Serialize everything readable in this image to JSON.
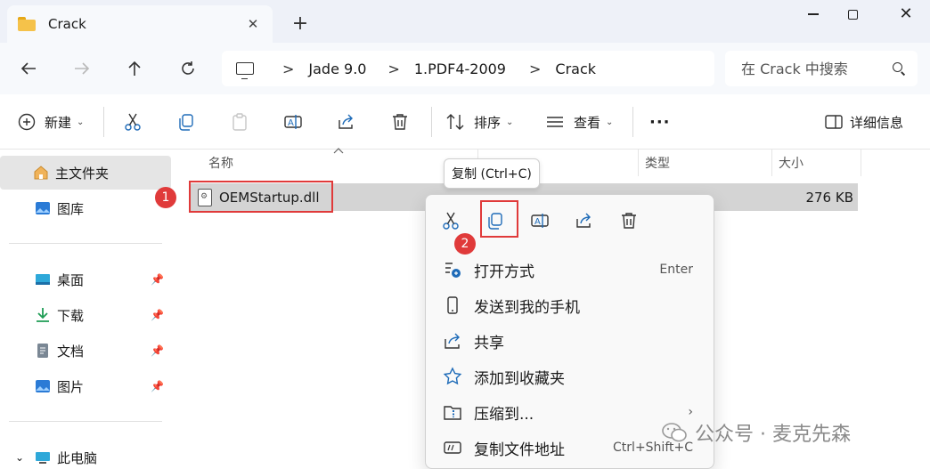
{
  "window": {
    "tab_title": "Crack",
    "new_tab": "+",
    "close_tab": "✕"
  },
  "address": {
    "crumbs": [
      "Jade 9.0",
      "1.PDF4-2009",
      "Crack"
    ],
    "separator": ">"
  },
  "search": {
    "placeholder": "在 Crack 中搜索"
  },
  "toolbar": {
    "new_label": "新建",
    "sort_label": "排序",
    "view_label": "查看",
    "more_label": "···",
    "details_label": "详细信息"
  },
  "sidebar": {
    "items": [
      {
        "label": "主文件夹"
      },
      {
        "label": "图库"
      },
      {
        "label": "桌面"
      },
      {
        "label": "下载"
      },
      {
        "label": "文档"
      },
      {
        "label": "图片"
      },
      {
        "label": "此电脑"
      }
    ]
  },
  "columns": {
    "name": "名称",
    "type": "类型",
    "size": "大小"
  },
  "file": {
    "name": "OEMStartup.dll",
    "size": "276 KB"
  },
  "tooltip": {
    "text": "复制 (Ctrl+C)"
  },
  "badges": {
    "one": "1",
    "two": "2"
  },
  "context_menu": {
    "items": [
      {
        "label": "打开方式",
        "shortcut": "Enter"
      },
      {
        "label": "发送到我的手机",
        "shortcut": ""
      },
      {
        "label": "共享",
        "shortcut": ""
      },
      {
        "label": "添加到收藏夹",
        "shortcut": ""
      },
      {
        "label": "压缩到...",
        "shortcut": ""
      },
      {
        "label": "复制文件地址",
        "shortcut": "Ctrl+Shift+C"
      }
    ],
    "submenu_arrow": "›"
  },
  "watermark": {
    "text": "公众号 · 麦克先森"
  },
  "colors": {
    "accent": "#0067c0",
    "highlight_red": "#e03a3a",
    "selection": "#d4d4d4"
  }
}
